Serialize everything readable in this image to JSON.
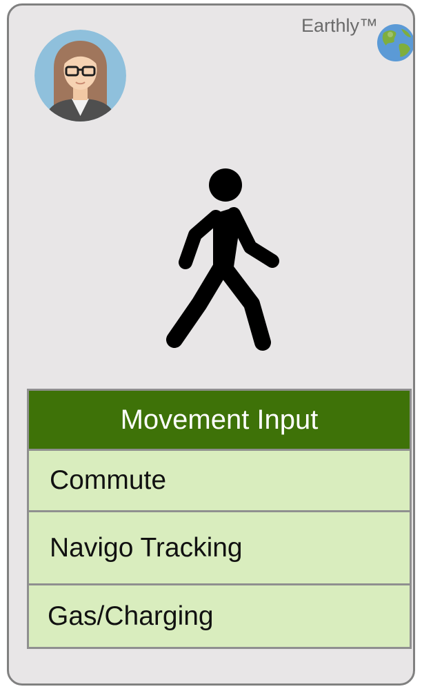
{
  "brand": {
    "name": "Earthly™",
    "icon": "globe-icon"
  },
  "profile": {
    "icon": "user-avatar-icon"
  },
  "activity": {
    "icon": "walking-person-icon"
  },
  "menu": {
    "title": "Movement Input",
    "items": [
      {
        "label": "Commute"
      },
      {
        "label": "Navigo Tracking"
      },
      {
        "label": "Gas/Charging"
      }
    ]
  },
  "colors": {
    "header_green": "#3e7208",
    "item_green": "#d9edbe",
    "panel_gray": "#e8e6e7",
    "border_gray": "#808080"
  }
}
